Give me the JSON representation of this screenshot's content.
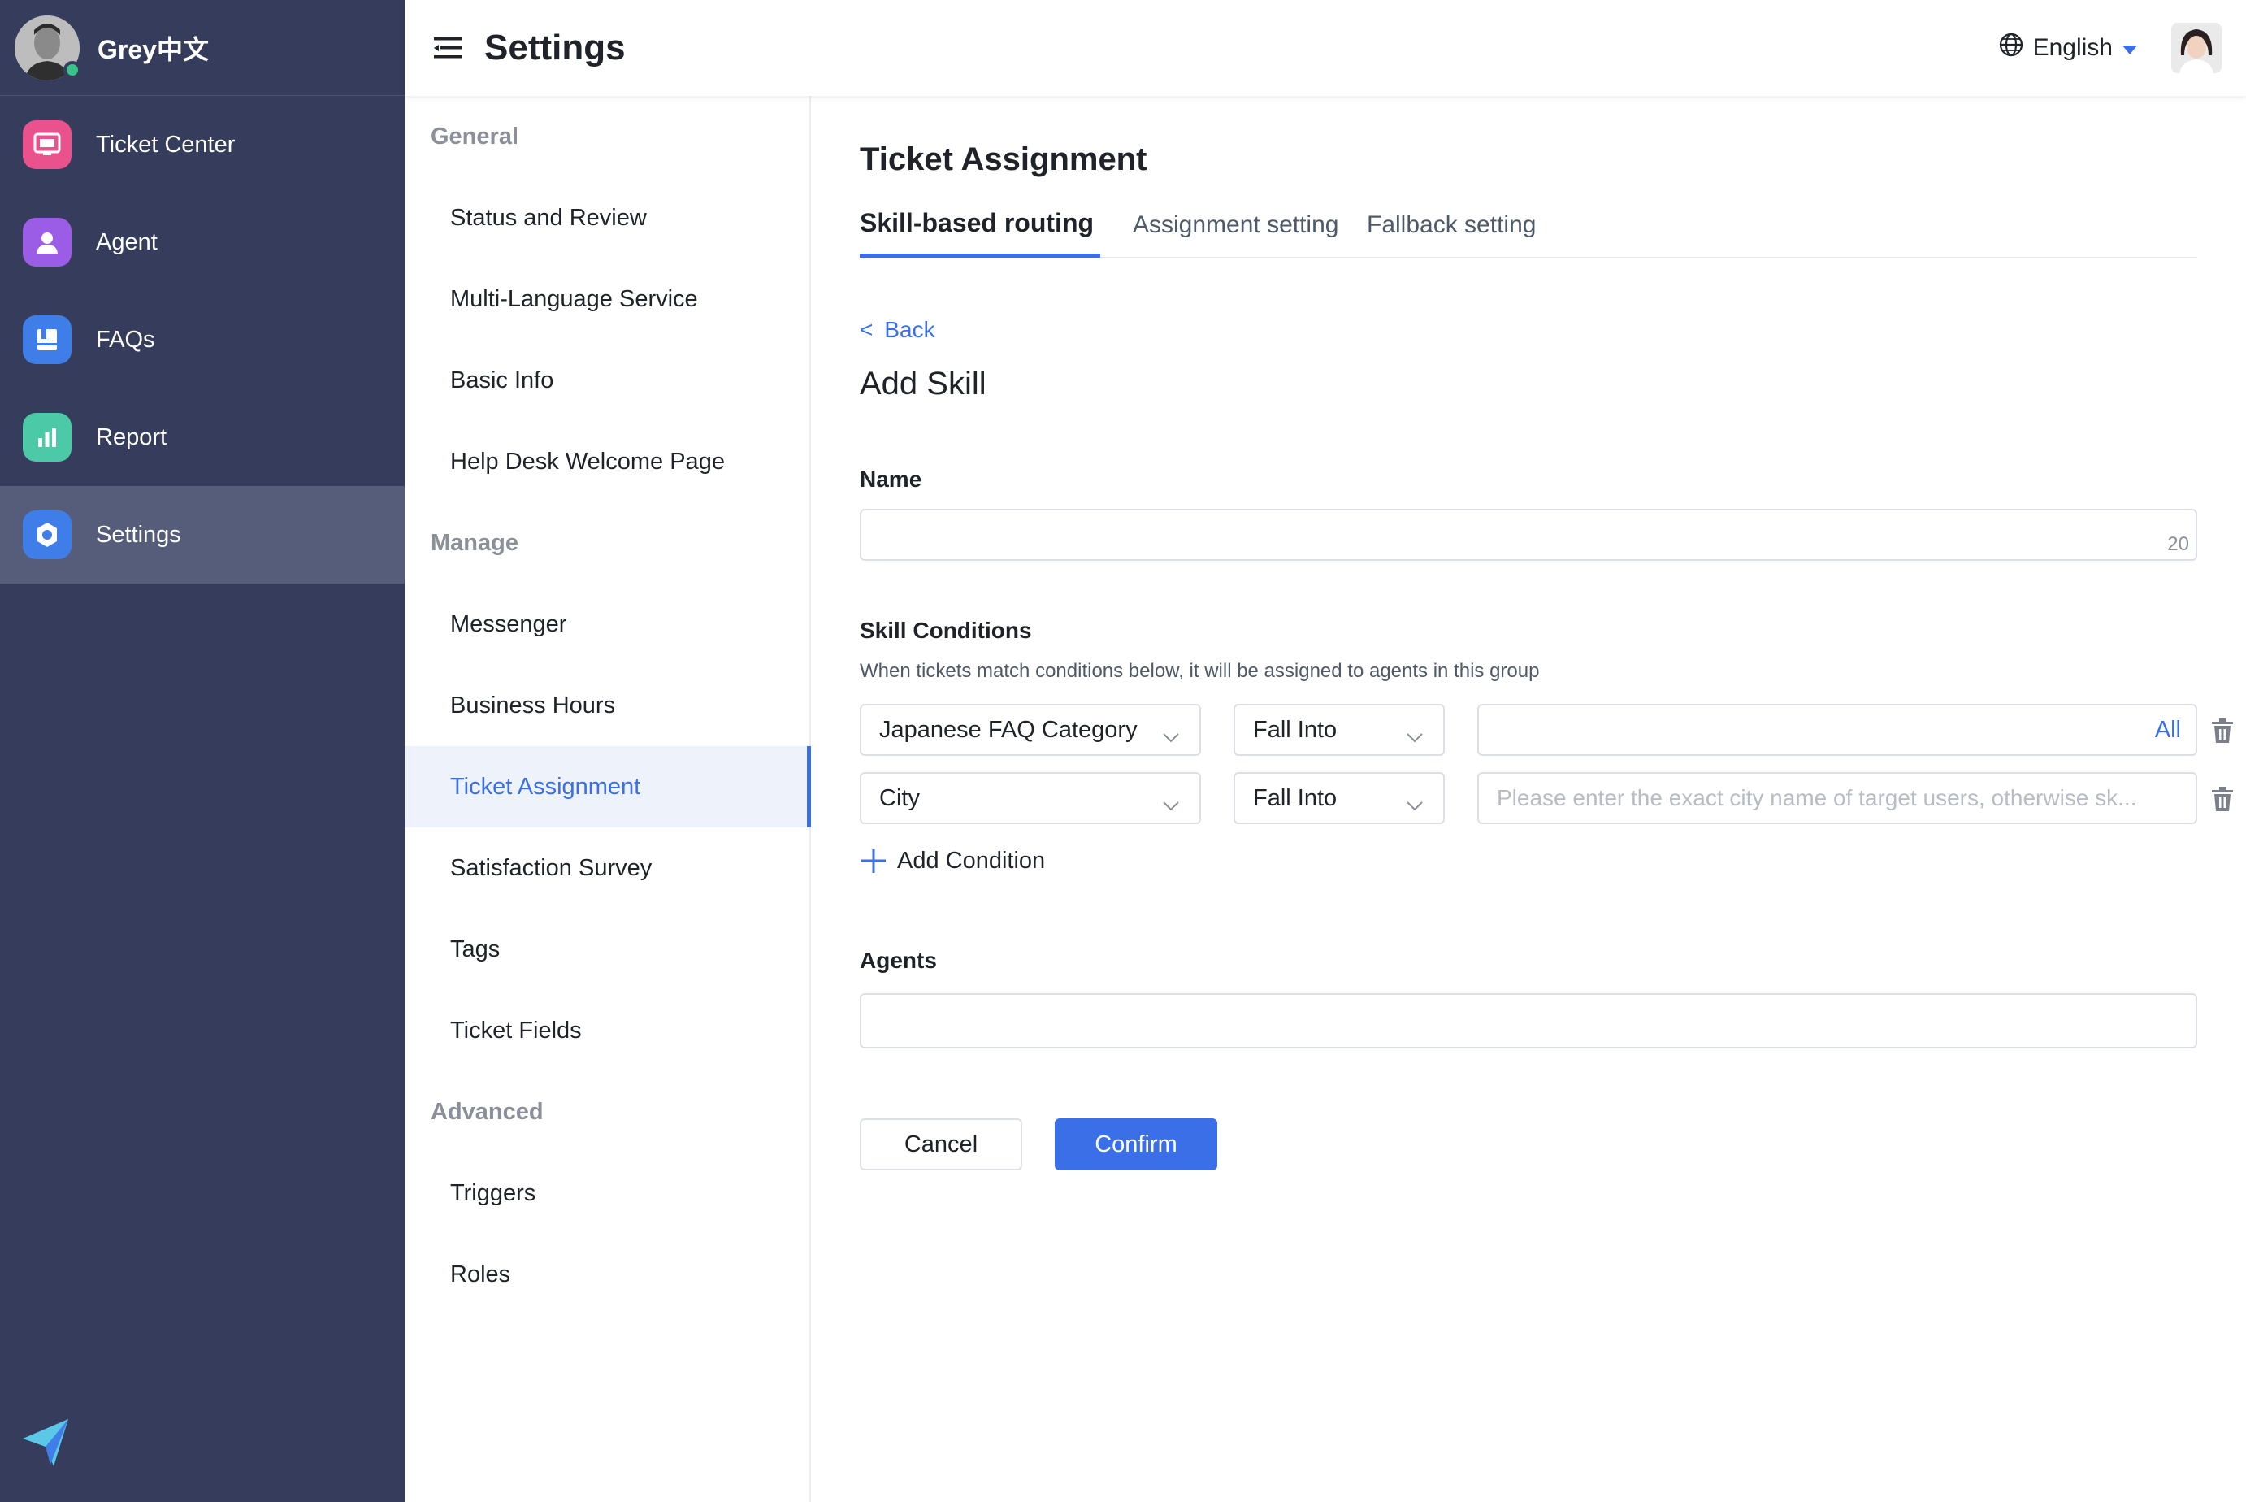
{
  "user": {
    "name": "Grey中文"
  },
  "nav": {
    "items": [
      {
        "label": "Ticket Center",
        "icon": "ticket-center-icon",
        "color": "#e9528d"
      },
      {
        "label": "Agent",
        "icon": "agent-icon",
        "color": "#9b5de5"
      },
      {
        "label": "FAQs",
        "icon": "faqs-icon",
        "color": "#3f7ee8"
      },
      {
        "label": "Report",
        "icon": "report-icon",
        "color": "#4cc9a6"
      },
      {
        "label": "Settings",
        "icon": "gear-icon",
        "color": "#3f7ee8"
      }
    ],
    "active": "Settings"
  },
  "header": {
    "title": "Settings",
    "language": "English"
  },
  "submenu": {
    "general_label": "General",
    "general": [
      "Status and Review",
      "Multi-Language Service",
      "Basic Info",
      "Help Desk Welcome Page"
    ],
    "manage_label": "Manage",
    "manage": [
      "Messenger",
      "Business Hours",
      "Ticket Assignment",
      "Satisfaction Survey",
      "Tags",
      "Ticket Fields"
    ],
    "advanced_label": "Advanced",
    "advanced": [
      "Triggers",
      "Roles"
    ],
    "active": "Ticket Assignment"
  },
  "main": {
    "section_title": "Ticket Assignment",
    "tabs": [
      "Skill-based routing",
      "Assignment setting",
      "Fallback setting"
    ],
    "active_tab": "Skill-based routing",
    "back_label": "Back",
    "form_title": "Add Skill",
    "name_label": "Name",
    "name_value": "",
    "name_counter": "20",
    "conditions_label": "Skill Conditions",
    "conditions_hint": "When tickets match conditions below, it will be assigned to agents in this group",
    "conditions": [
      {
        "field": "Japanese FAQ Category",
        "operator": "Fall Into",
        "value": "",
        "value_link": "All"
      },
      {
        "field": "City",
        "operator": "Fall Into",
        "value": "",
        "placeholder": "Please enter the exact city name of target users, otherwise sk..."
      }
    ],
    "add_condition_label": "Add Condition",
    "agents_label": "Agents",
    "agents_value": "",
    "cancel_label": "Cancel",
    "confirm_label": "Confirm"
  },
  "colors": {
    "accent": "#3b6fe8",
    "nav_bg": "#363d5c",
    "nav_active": "#565d7a",
    "status_online": "#39c48a"
  }
}
